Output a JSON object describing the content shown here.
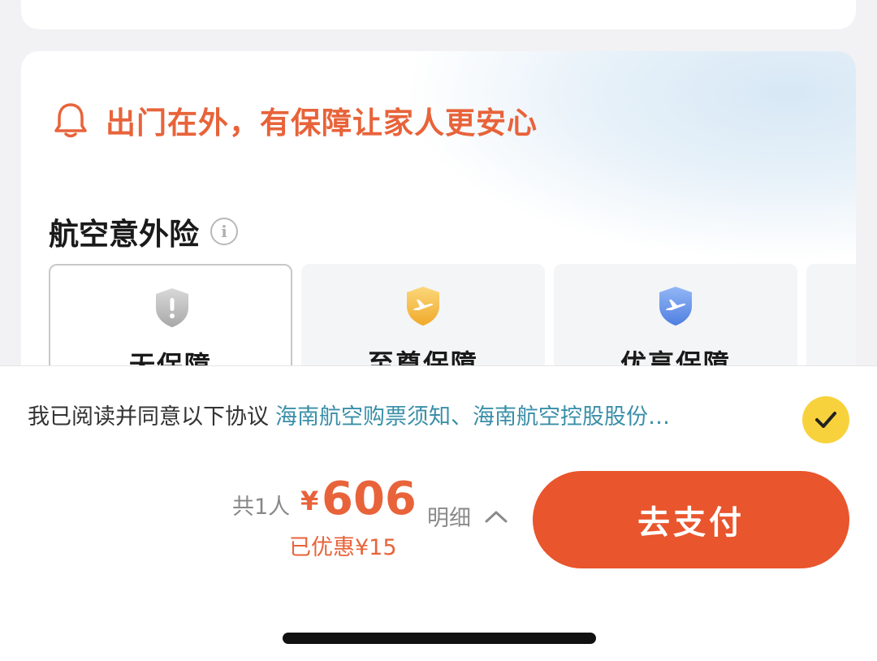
{
  "insurance": {
    "banner_text": "出门在外，有保障让家人更安心",
    "section_title": "航空意外险",
    "info_icon_glyph": "i",
    "options": [
      {
        "label": "无保障",
        "icon": "shield-warning-icon",
        "selected": true
      },
      {
        "label": "至尊保障",
        "icon": "shield-plane-gold-icon",
        "selected": false
      },
      {
        "label": "优享保障",
        "icon": "shield-plane-blue-icon",
        "selected": false
      }
    ]
  },
  "agreement": {
    "prefix": "我已阅读并同意以下协议",
    "links": "海南航空购票须知、海南航空控股股份…",
    "checked": true
  },
  "checkout": {
    "count": "共1人",
    "currency": "¥",
    "amount": "606",
    "discount": "已优惠¥15",
    "detail_label": "明细",
    "pay_label": "去支付"
  },
  "colors": {
    "accent": "#e8633a",
    "pay_button": "#e9552c",
    "link": "#3a8fa8",
    "check": "#f7d23c"
  }
}
